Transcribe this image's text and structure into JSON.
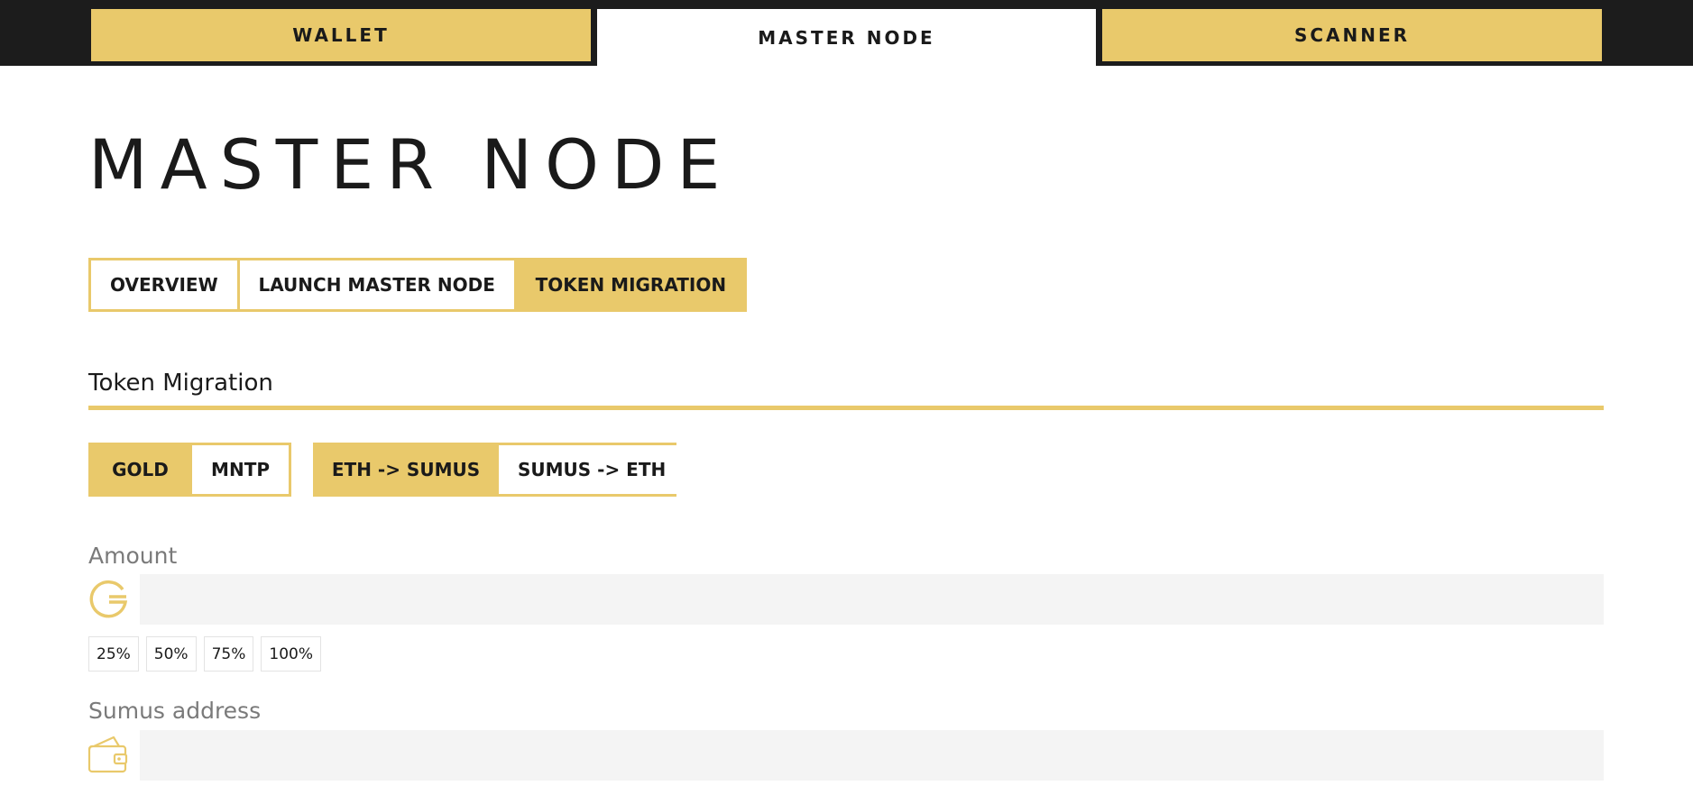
{
  "topnav": {
    "tabs": [
      {
        "label": "WALLET",
        "active": false
      },
      {
        "label": "MASTER NODE",
        "active": true
      },
      {
        "label": "SCANNER",
        "active": false
      }
    ]
  },
  "page": {
    "title": "MASTER NODE"
  },
  "section_tabs": [
    {
      "label": "OVERVIEW",
      "active": false
    },
    {
      "label": "LAUNCH MASTER NODE",
      "active": false
    },
    {
      "label": "TOKEN MIGRATION",
      "active": true
    }
  ],
  "migration": {
    "title": "Token Migration",
    "token_toggle": [
      {
        "label": "GOLD",
        "active": true
      },
      {
        "label": "MNTP",
        "active": false
      }
    ],
    "direction_toggle": [
      {
        "label": "ETH -> SUMUS",
        "active": true
      },
      {
        "label": "SUMUS -> ETH",
        "active": false
      }
    ],
    "amount": {
      "label": "Amount",
      "value": "",
      "icon": "gold-coin-icon"
    },
    "percent_buttons": [
      "25%",
      "50%",
      "75%",
      "100%"
    ],
    "address": {
      "label": "Sumus address",
      "value": "",
      "icon": "wallet-icon"
    }
  },
  "colors": {
    "accent": "#e9c96b",
    "topbar": "#1c1c1c",
    "input_bg": "#f4f4f4",
    "label_gray": "#7a7a7a"
  }
}
